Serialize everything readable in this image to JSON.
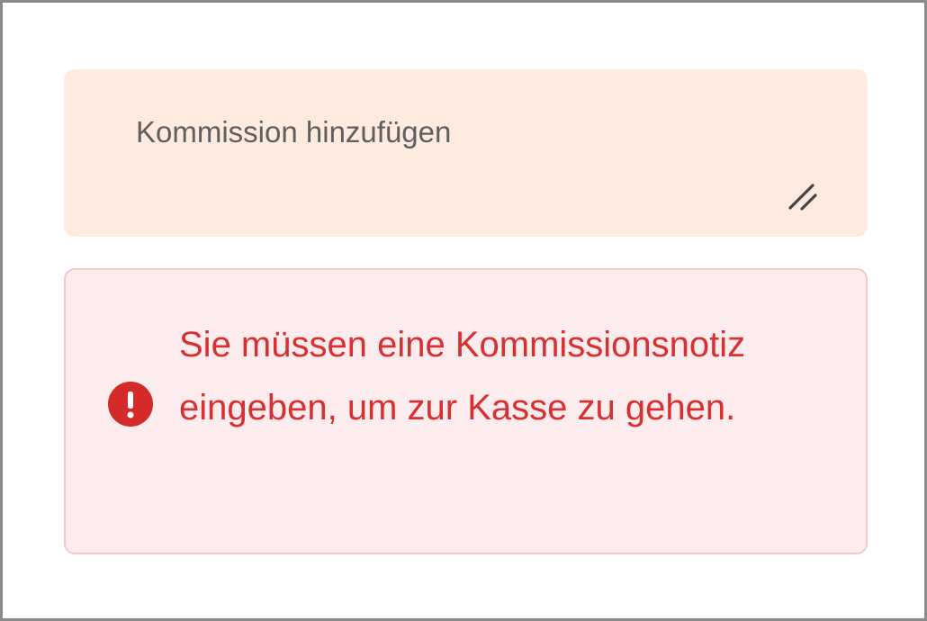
{
  "comment_field": {
    "placeholder": "Kommission hinzufügen",
    "value": "",
    "resize_icon": "resize-handle-icon",
    "background_color": "#feeadf"
  },
  "error_message": {
    "icon": "exclamation-circle-icon",
    "text": "Sie müssen eine Kommissionsnotiz eingeben, um zur Kasse zu gehen.",
    "text_color": "#d63031",
    "background_color": "#fdecee",
    "border_color": "#f3c9cc"
  }
}
